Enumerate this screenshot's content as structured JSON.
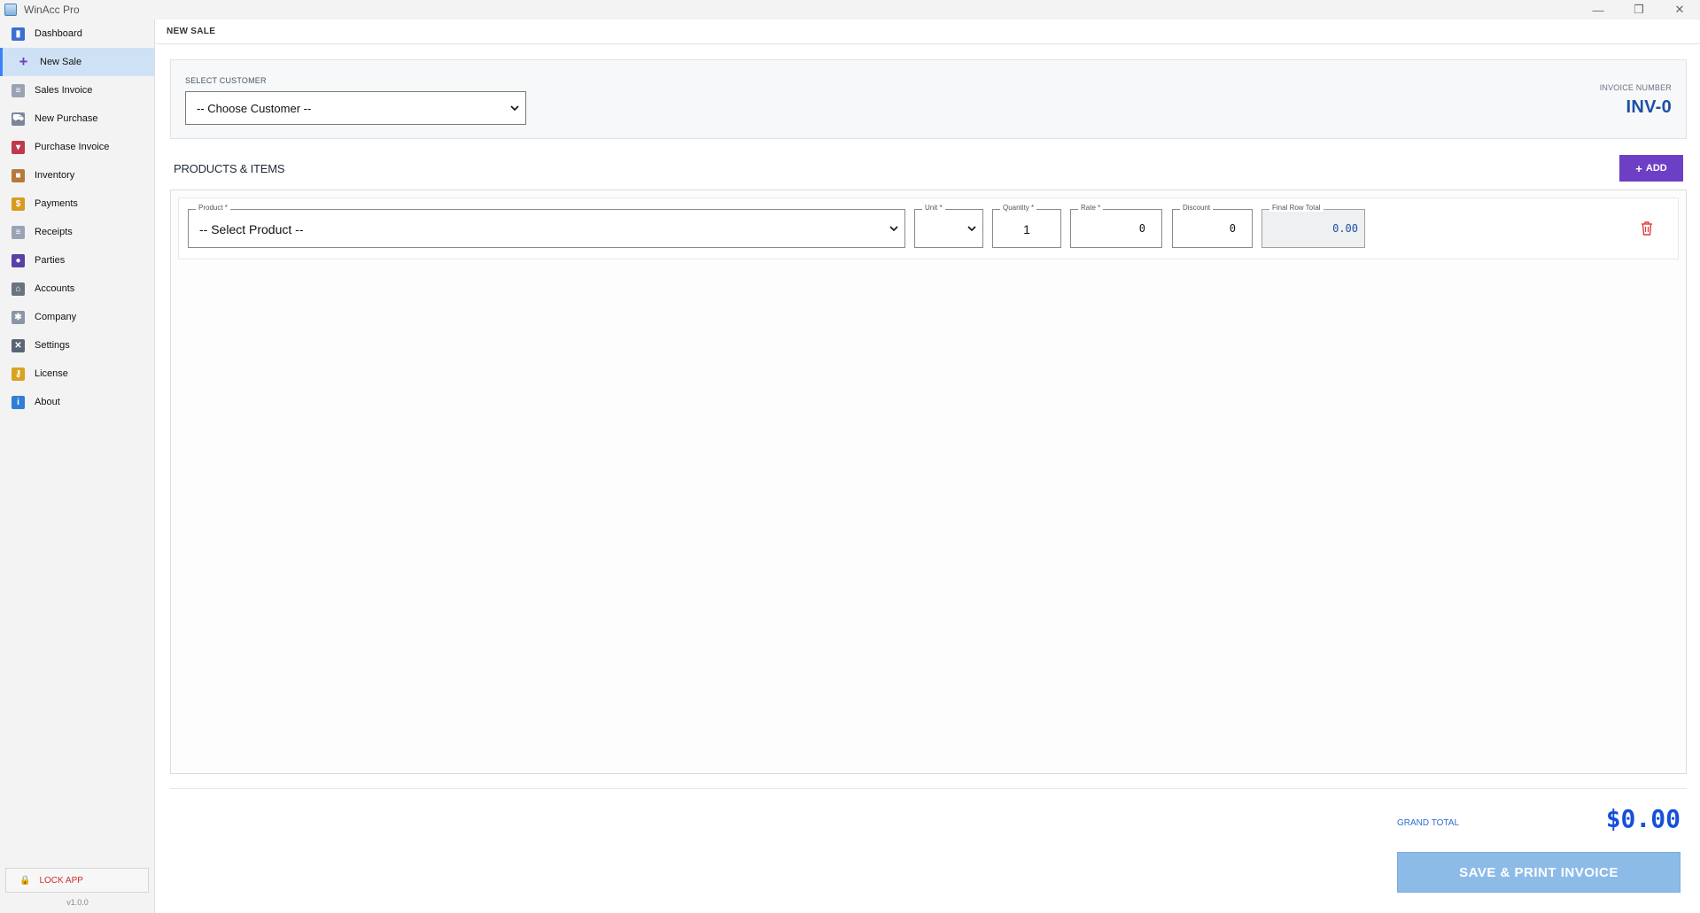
{
  "window": {
    "title": "WinAcc Pro",
    "controls": [
      "—",
      "❐",
      "✕"
    ]
  },
  "sidebar": {
    "items": [
      {
        "label": "Dashboard",
        "icon": "chart-icon",
        "color": "#3b6fd4"
      },
      {
        "label": "New Sale",
        "icon": "plus-icon",
        "color": "#6d3fc4",
        "active": true
      },
      {
        "label": "Sales Invoice",
        "icon": "document-icon",
        "color": "#9aa3b5"
      },
      {
        "label": "New Purchase",
        "icon": "cart-icon",
        "color": "#7a8699"
      },
      {
        "label": "Purchase Invoice",
        "icon": "inbox-icon",
        "color": "#c0394b"
      },
      {
        "label": "Inventory",
        "icon": "box-icon",
        "color": "#b7793a"
      },
      {
        "label": "Payments",
        "icon": "money-bag-icon",
        "color": "#d99a1f"
      },
      {
        "label": "Receipts",
        "icon": "receipt-icon",
        "color": "#9aa3b5"
      },
      {
        "label": "Parties",
        "icon": "users-icon",
        "color": "#5b3fa8"
      },
      {
        "label": "Accounts",
        "icon": "bank-icon",
        "color": "#6b7280"
      },
      {
        "label": "Company",
        "icon": "gear-icon",
        "color": "#8b95a5"
      },
      {
        "label": "Settings",
        "icon": "tools-icon",
        "color": "#5a6578"
      },
      {
        "label": "License",
        "icon": "key-icon",
        "color": "#d9a21f"
      },
      {
        "label": "About",
        "icon": "info-icon",
        "color": "#2f7fd6"
      }
    ],
    "lock_label": "LOCK APP",
    "version": "v1.0.0"
  },
  "header": {
    "title": "NEW SALE"
  },
  "customer": {
    "label": "SELECT CUSTOMER",
    "selected": "-- Choose Customer --"
  },
  "invoice": {
    "label": "INVOICE NUMBER",
    "number": "INV-0"
  },
  "products": {
    "title": "PRODUCTS & ITEMS",
    "add_label": "ADD",
    "row": {
      "product_label": "Product *",
      "product_value": "-- Select Product --",
      "unit_label": "Unit *",
      "unit_value": "",
      "quantity_label": "Quantity *",
      "quantity_value": "1",
      "rate_label": "Rate *",
      "rate_value": "0",
      "discount_label": "Discount",
      "discount_value": "0",
      "total_label": "Final Row Total",
      "total_value": "0.00"
    }
  },
  "footer": {
    "grand_total_label": "GRAND TOTAL",
    "grand_total_value": "$0.00",
    "save_label": "SAVE & PRINT INVOICE"
  },
  "colors": {
    "accent_purple": "#6d3fc4",
    "invoice_blue": "#1e4fa8",
    "grand_total_blue": "#1550d8",
    "save_button": "#8dbbe8",
    "lock_red": "#d12c2c"
  }
}
